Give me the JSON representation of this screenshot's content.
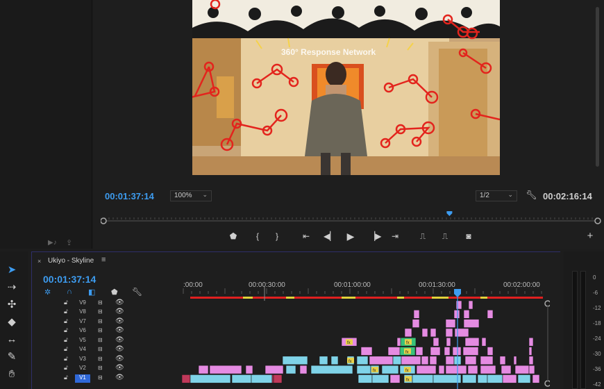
{
  "monitor": {
    "video_overlay_text": "360° Response Network",
    "current_timecode": "00:01:37:14",
    "zoom_level": "100%",
    "resolution": "1/2",
    "duration_timecode": "00:02:16:14",
    "playhead_fraction": 0.7
  },
  "timeline": {
    "sequence_name": "Ukiyo - Skyline",
    "timecode": "00:01:37:14",
    "ruler_labels": [
      ":00:00",
      "00:00:30:00",
      "00:01:00:00",
      "00:01:30:00",
      "00:02:00:00"
    ],
    "tracks": [
      "V9",
      "V8",
      "V7",
      "V6",
      "V5",
      "V4",
      "V3",
      "V2",
      "V1"
    ],
    "active_track": "V1",
    "fx_label": "fx"
  },
  "meters": {
    "labels": [
      "0",
      "-6",
      "-12",
      "-18",
      "-24",
      "-30",
      "-36",
      "-42"
    ]
  },
  "colors": {
    "accent_blue": "#3d9cf0",
    "clip_pink": "#e58be2",
    "clip_cyan": "#7fd3e8",
    "clip_green": "#39c27a",
    "work_area_red": "#e02020"
  }
}
